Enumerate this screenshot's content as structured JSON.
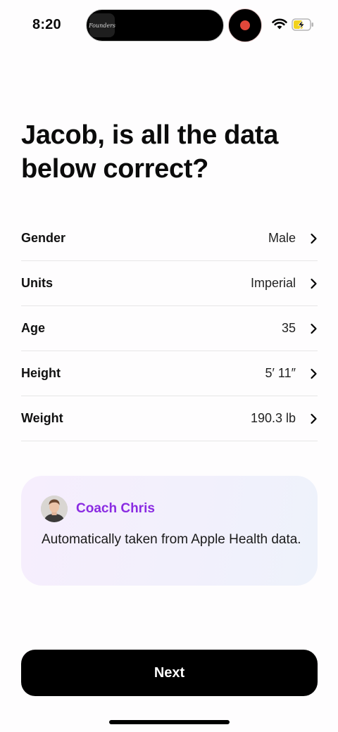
{
  "status_bar": {
    "time": "8:20",
    "island_thumbnail_text": "Founders",
    "recording_color": "#e2473a",
    "icons": [
      "wifi-icon",
      "battery-charging-icon"
    ]
  },
  "title": "Jacob, is all the data below correct?",
  "fields": [
    {
      "label": "Gender",
      "value": "Male"
    },
    {
      "label": "Units",
      "value": "Imperial"
    },
    {
      "label": "Age",
      "value": "35"
    },
    {
      "label": "Height",
      "value": "5′ 11″"
    },
    {
      "label": "Weight",
      "value": "190.3 lb"
    }
  ],
  "coach": {
    "name": "Coach Chris",
    "message": "Automatically taken from Apple Health data.",
    "name_color": "#8a2be2"
  },
  "next_label": "Next"
}
